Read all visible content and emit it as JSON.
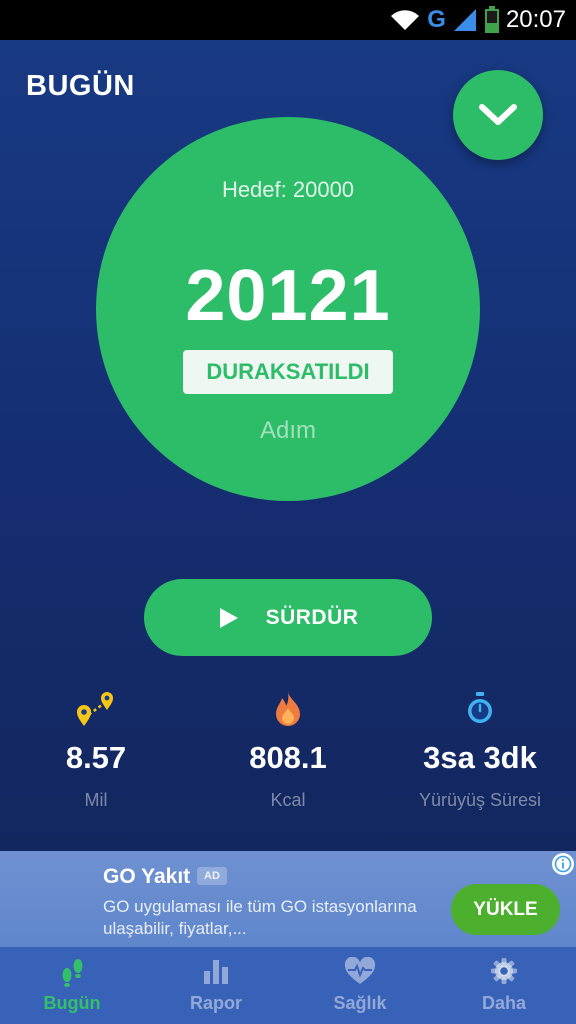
{
  "status_bar": {
    "time": "20:07",
    "network": "G"
  },
  "header": {
    "title": "BUGÜN"
  },
  "counter": {
    "goal_text": "Hedef: 20000",
    "steps": "20121",
    "paused_label": "DURAKSATILDI",
    "unit": "Adım"
  },
  "resume_button": {
    "label": "SÜRDÜR"
  },
  "stats": [
    {
      "icon": "map-pins-icon",
      "value": "8.57",
      "label": "Mil"
    },
    {
      "icon": "flame-icon",
      "value": "808.1",
      "label": "Kcal"
    },
    {
      "icon": "stopwatch-icon",
      "value": "3sa 3dk",
      "label": "Yürüyüş Süresi"
    }
  ],
  "ad": {
    "title": "GO Yakıt",
    "badge": "AD",
    "description": "GO uygulaması ile tüm GO istasyonlarına ulaşabilir, fiyatlar,...",
    "button": "YÜKLE"
  },
  "nav": [
    {
      "icon": "footsteps-icon",
      "label": "Bugün",
      "active": true
    },
    {
      "icon": "bar-chart-icon",
      "label": "Rapor",
      "active": false
    },
    {
      "icon": "heart-pulse-icon",
      "label": "Sağlık",
      "active": false
    },
    {
      "icon": "gear-icon",
      "label": "Daha",
      "active": false
    }
  ],
  "colors": {
    "accent": "#2dbd68",
    "background": "#183b85",
    "nav": "#3862b8"
  }
}
